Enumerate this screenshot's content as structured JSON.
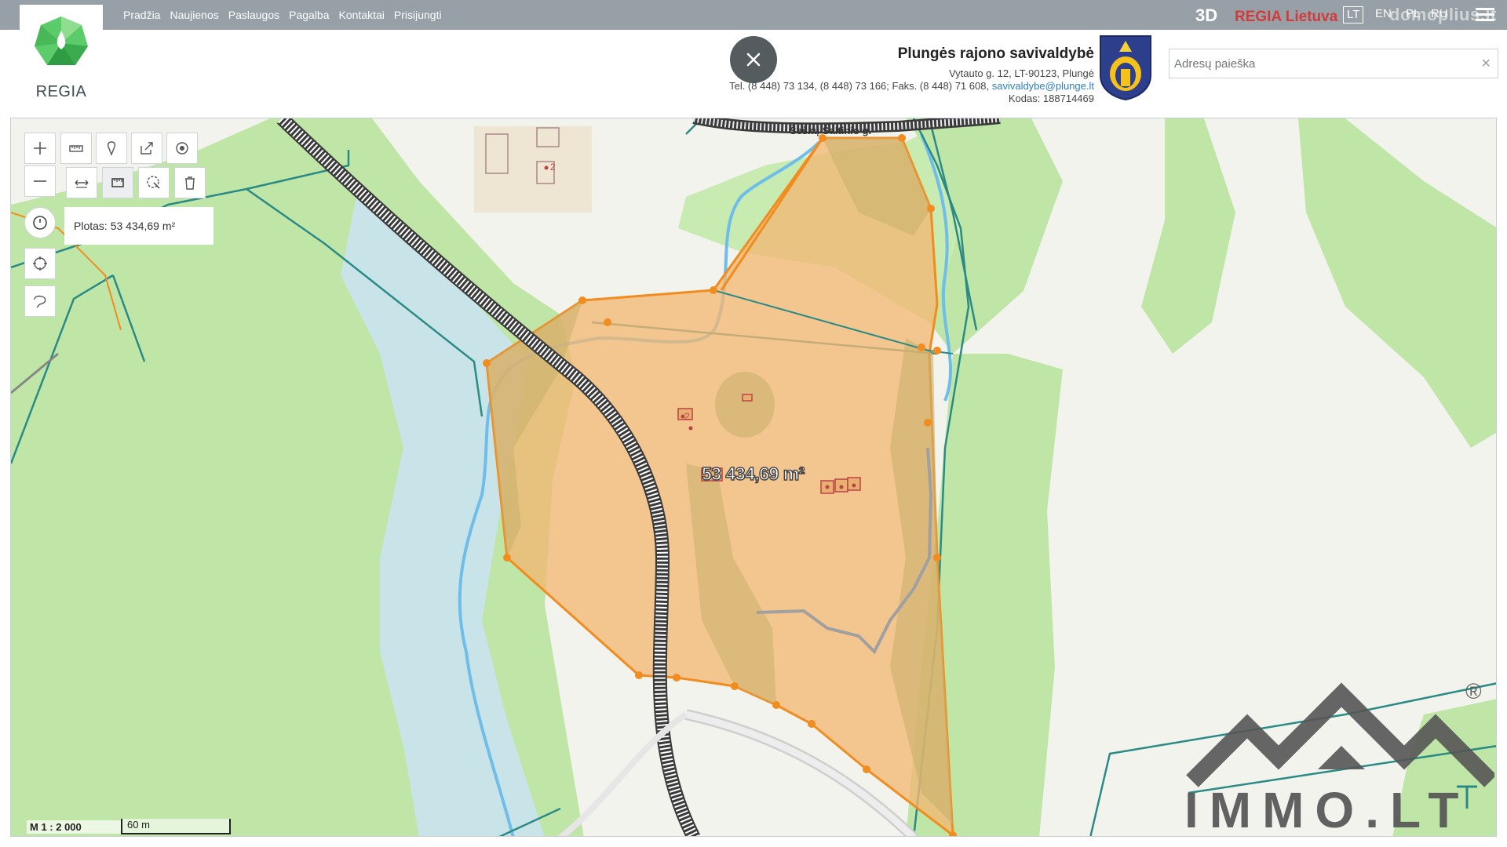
{
  "app": {
    "logo_text": "REGIA",
    "nav": [
      "Pradžia",
      "Naujienos",
      "Paslaugos",
      "Pagalba",
      "Kontaktai",
      "Prisijungti"
    ],
    "view_3d": "3D",
    "regia_lietuva": "REGIA Lietuva",
    "languages": [
      "LT",
      "EN",
      "PL",
      "RU"
    ],
    "active_language": "LT",
    "watermark": "domoplius.lt"
  },
  "municipality": {
    "name": "Plungės rajono savivaldybė",
    "address": "Vytauto g. 12, LT-90123, Plungė",
    "contacts_prefix": "Tel. (8 448) 73 134, (8 448) 73 166; Faks. (8 448) 71 608,",
    "email": "savivaldybe@plunge.lt",
    "code": "Kodas: 188714469"
  },
  "search": {
    "placeholder": "Adresų paieška",
    "value": ""
  },
  "map": {
    "area_info": "Plotas: 53 434,69 m²",
    "area_label": "53 434,69 m²",
    "street_name": "Šeškų Šaltinio g.",
    "scale_ratio": "M 1 : 2 000",
    "scale_length": "60 m",
    "parcel_numbers": [
      "2",
      "2"
    ],
    "watermark_brand": "IMMO.LT",
    "watermark_reg": "®"
  },
  "toolbar": {
    "icons": [
      "zoom-in-icon",
      "zoom-out-icon",
      "ruler-icon",
      "marker-icon",
      "share-icon",
      "target-icon",
      "measure-distance-icon",
      "measure-area-icon",
      "select-icon",
      "trash-icon",
      "history-icon",
      "locate-icon",
      "lasso-icon"
    ]
  },
  "colors": {
    "topbar": "#96a0a6",
    "forest": "#bfe6a6",
    "field": "#f5f5ea",
    "parcel_fill": "#f2b774",
    "parcel_stroke": "#f28c1e",
    "water": "#69b7e6",
    "cadastre_line": "#2a8b86",
    "regia_red": "#d23b3b"
  }
}
